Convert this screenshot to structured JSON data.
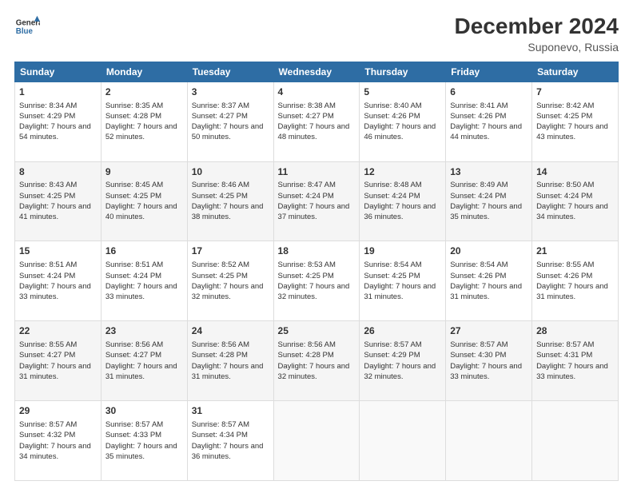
{
  "header": {
    "logo_line1": "General",
    "logo_line2": "Blue",
    "title": "December 2024",
    "subtitle": "Suponevo, Russia"
  },
  "days_of_week": [
    "Sunday",
    "Monday",
    "Tuesday",
    "Wednesday",
    "Thursday",
    "Friday",
    "Saturday"
  ],
  "weeks": [
    [
      {
        "day": "1",
        "sunrise": "8:34 AM",
        "sunset": "4:29 PM",
        "daylight": "7 hours and 54 minutes."
      },
      {
        "day": "2",
        "sunrise": "8:35 AM",
        "sunset": "4:28 PM",
        "daylight": "7 hours and 52 minutes."
      },
      {
        "day": "3",
        "sunrise": "8:37 AM",
        "sunset": "4:27 PM",
        "daylight": "7 hours and 50 minutes."
      },
      {
        "day": "4",
        "sunrise": "8:38 AM",
        "sunset": "4:27 PM",
        "daylight": "7 hours and 48 minutes."
      },
      {
        "day": "5",
        "sunrise": "8:40 AM",
        "sunset": "4:26 PM",
        "daylight": "7 hours and 46 minutes."
      },
      {
        "day": "6",
        "sunrise": "8:41 AM",
        "sunset": "4:26 PM",
        "daylight": "7 hours and 44 minutes."
      },
      {
        "day": "7",
        "sunrise": "8:42 AM",
        "sunset": "4:25 PM",
        "daylight": "7 hours and 43 minutes."
      }
    ],
    [
      {
        "day": "8",
        "sunrise": "8:43 AM",
        "sunset": "4:25 PM",
        "daylight": "7 hours and 41 minutes."
      },
      {
        "day": "9",
        "sunrise": "8:45 AM",
        "sunset": "4:25 PM",
        "daylight": "7 hours and 40 minutes."
      },
      {
        "day": "10",
        "sunrise": "8:46 AM",
        "sunset": "4:25 PM",
        "daylight": "7 hours and 38 minutes."
      },
      {
        "day": "11",
        "sunrise": "8:47 AM",
        "sunset": "4:24 PM",
        "daylight": "7 hours and 37 minutes."
      },
      {
        "day": "12",
        "sunrise": "8:48 AM",
        "sunset": "4:24 PM",
        "daylight": "7 hours and 36 minutes."
      },
      {
        "day": "13",
        "sunrise": "8:49 AM",
        "sunset": "4:24 PM",
        "daylight": "7 hours and 35 minutes."
      },
      {
        "day": "14",
        "sunrise": "8:50 AM",
        "sunset": "4:24 PM",
        "daylight": "7 hours and 34 minutes."
      }
    ],
    [
      {
        "day": "15",
        "sunrise": "8:51 AM",
        "sunset": "4:24 PM",
        "daylight": "7 hours and 33 minutes."
      },
      {
        "day": "16",
        "sunrise": "8:51 AM",
        "sunset": "4:24 PM",
        "daylight": "7 hours and 33 minutes."
      },
      {
        "day": "17",
        "sunrise": "8:52 AM",
        "sunset": "4:25 PM",
        "daylight": "7 hours and 32 minutes."
      },
      {
        "day": "18",
        "sunrise": "8:53 AM",
        "sunset": "4:25 PM",
        "daylight": "7 hours and 32 minutes."
      },
      {
        "day": "19",
        "sunrise": "8:54 AM",
        "sunset": "4:25 PM",
        "daylight": "7 hours and 31 minutes."
      },
      {
        "day": "20",
        "sunrise": "8:54 AM",
        "sunset": "4:26 PM",
        "daylight": "7 hours and 31 minutes."
      },
      {
        "day": "21",
        "sunrise": "8:55 AM",
        "sunset": "4:26 PM",
        "daylight": "7 hours and 31 minutes."
      }
    ],
    [
      {
        "day": "22",
        "sunrise": "8:55 AM",
        "sunset": "4:27 PM",
        "daylight": "7 hours and 31 minutes."
      },
      {
        "day": "23",
        "sunrise": "8:56 AM",
        "sunset": "4:27 PM",
        "daylight": "7 hours and 31 minutes."
      },
      {
        "day": "24",
        "sunrise": "8:56 AM",
        "sunset": "4:28 PM",
        "daylight": "7 hours and 31 minutes."
      },
      {
        "day": "25",
        "sunrise": "8:56 AM",
        "sunset": "4:28 PM",
        "daylight": "7 hours and 32 minutes."
      },
      {
        "day": "26",
        "sunrise": "8:57 AM",
        "sunset": "4:29 PM",
        "daylight": "7 hours and 32 minutes."
      },
      {
        "day": "27",
        "sunrise": "8:57 AM",
        "sunset": "4:30 PM",
        "daylight": "7 hours and 33 minutes."
      },
      {
        "day": "28",
        "sunrise": "8:57 AM",
        "sunset": "4:31 PM",
        "daylight": "7 hours and 33 minutes."
      }
    ],
    [
      {
        "day": "29",
        "sunrise": "8:57 AM",
        "sunset": "4:32 PM",
        "daylight": "7 hours and 34 minutes."
      },
      {
        "day": "30",
        "sunrise": "8:57 AM",
        "sunset": "4:33 PM",
        "daylight": "7 hours and 35 minutes."
      },
      {
        "day": "31",
        "sunrise": "8:57 AM",
        "sunset": "4:34 PM",
        "daylight": "7 hours and 36 minutes."
      },
      null,
      null,
      null,
      null
    ]
  ]
}
